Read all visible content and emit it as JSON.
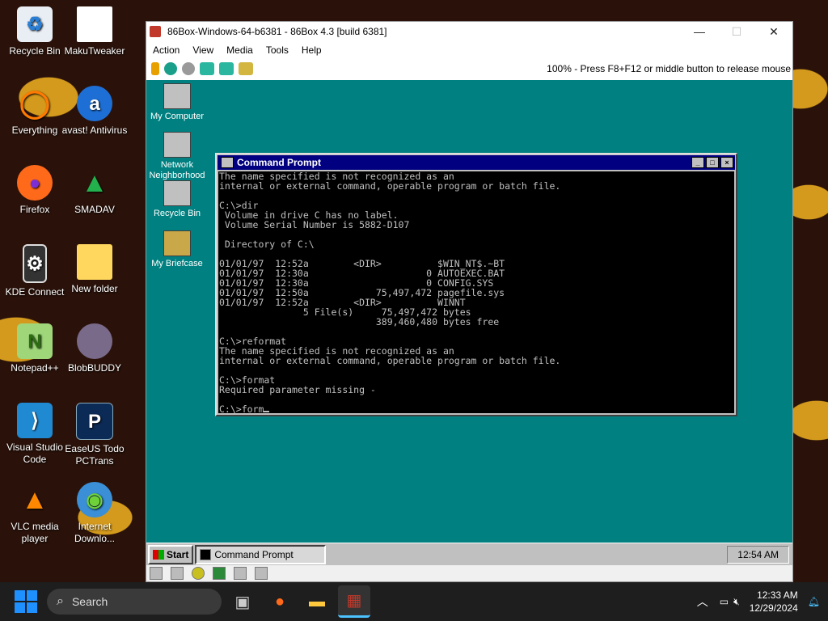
{
  "desktop_icons": [
    {
      "label": "Recycle Bin"
    },
    {
      "label": "MakuTweaker"
    },
    {
      "label": "Everything"
    },
    {
      "label": "avast! Antivirus"
    },
    {
      "label": "Firefox"
    },
    {
      "label": "SMADAV"
    },
    {
      "label": "KDE Connect"
    },
    {
      "label": "New folder"
    },
    {
      "label": "Notepad++"
    },
    {
      "label": "BlobBUDDY"
    },
    {
      "label": "Visual Studio Code"
    },
    {
      "label": "EaseUS Todo PCTrans"
    },
    {
      "label": "VLC media player"
    },
    {
      "label": "Internet Downlo..."
    }
  ],
  "vm_window": {
    "title": "86Box-Windows-64-b6381 - 86Box 4.3 [build 6381]",
    "menu": [
      "Action",
      "View",
      "Media",
      "Tools",
      "Help"
    ],
    "status": "100% - Press F8+F12 or middle button to release mouse"
  },
  "guest": {
    "icons": [
      {
        "label": "My Computer"
      },
      {
        "label": "Network Neighborhood"
      },
      {
        "label": "Recycle Bin"
      },
      {
        "label": "My Briefcase"
      }
    ],
    "cmd_title": "Command Prompt",
    "console_lines": [
      "The name specified is not recognized as an",
      "internal or external command, operable program or batch file.",
      "",
      "C:\\>dir",
      " Volume in drive C has no label.",
      " Volume Serial Number is 5882-D107",
      "",
      " Directory of C:\\",
      "",
      "01/01/97  12:52a        <DIR>          $WIN_NT$.~BT",
      "01/01/97  12:30a                     0 AUTOEXEC.BAT",
      "01/01/97  12:30a                     0 CONFIG.SYS",
      "01/01/97  12:50a            75,497,472 pagefile.sys",
      "01/01/97  12:52a        <DIR>          WINNT",
      "               5 File(s)     75,497,472 bytes",
      "                            389,460,480 bytes free",
      "",
      "C:\\>reformat",
      "The name specified is not recognized as an",
      "internal or external command, operable program or batch file.",
      "",
      "C:\\>format",
      "Required parameter missing -",
      ""
    ],
    "prompt_input": "C:\\>form",
    "start_label": "Start",
    "taskbar_task": "Command Prompt",
    "clock": "12:54 AM"
  },
  "taskbar": {
    "search_placeholder": "Search",
    "time": "12:33 AM",
    "date": "12/29/2024"
  }
}
